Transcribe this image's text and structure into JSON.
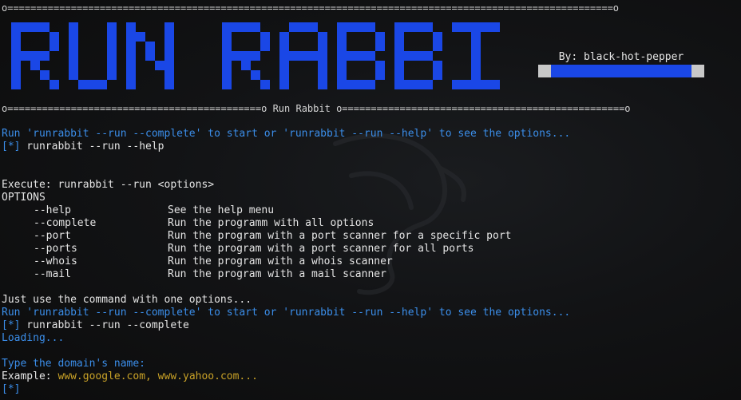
{
  "rules": {
    "top": "o=========================================================================================================o",
    "middle_left": "o============================================o",
    "middle_title": "Run Rabbit",
    "middle_right": "o=================================================o"
  },
  "banner": {
    "text": "RUN RABBIT",
    "color": "#1a47e6"
  },
  "author": {
    "label": "By: black-hot-pepper"
  },
  "session": {
    "hint1": "Run 'runrabbit --run --complete' to start or 'runrabbit --run --help' to see the options...",
    "prompt1_marker": "[*]",
    "prompt1_cmd": " runrabbit --run --help",
    "execute": "Execute: runrabbit --run <options>",
    "options_header": "OPTIONS",
    "options": [
      {
        "flag": "--help",
        "desc": "See the help menu"
      },
      {
        "flag": "--complete",
        "desc": "Run the programm with all options"
      },
      {
        "flag": "--port",
        "desc": "Run the program with a port scanner for a specific port"
      },
      {
        "flag": "--ports",
        "desc": "Run the program with a port scanner for all ports"
      },
      {
        "flag": "--whois",
        "desc": "Run the program with a whois scanner"
      },
      {
        "flag": "--mail",
        "desc": "Run the program with a mail scanner"
      }
    ],
    "just_use": "Just use the command with one options...",
    "hint2": "Run 'runrabbit --run --complete' to start or 'runrabbit --run --help' to see the options...",
    "prompt2_marker": "[*]",
    "prompt2_cmd": " runrabbit --run --complete",
    "loading": "Loading...",
    "type_domain": "Type the domain's name:",
    "example_label": "Example: ",
    "example_value": "www.google.com, www.yahoo.com...",
    "prompt3_marker": "[*]"
  },
  "colors": {
    "background": "#0c0c0c",
    "text": "#d4d4d4",
    "hint": "#3b8eea",
    "example": "#c9a227",
    "banner": "#1a47e6"
  }
}
